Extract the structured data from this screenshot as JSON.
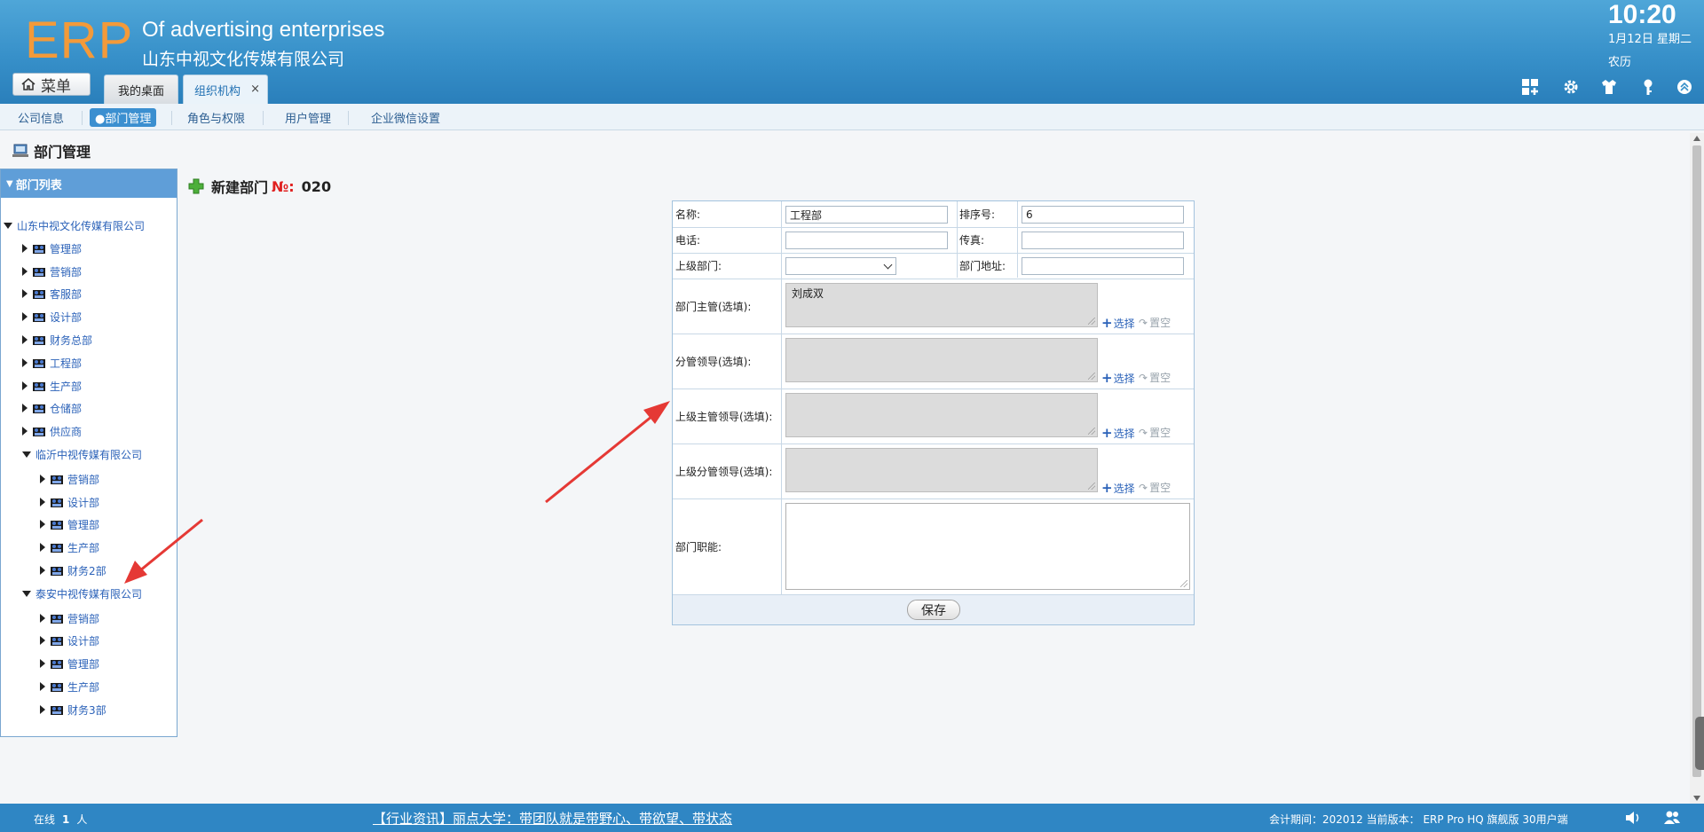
{
  "header": {
    "logo": "ERP",
    "company_en": "Of advertising enterprises",
    "company_cn": "山东中视文化传媒有限公司",
    "time": "10:20",
    "date": "1月12日 星期二",
    "lunar": "农历",
    "menu_label": "菜单",
    "tabs": [
      {
        "label": "我的桌面"
      },
      {
        "label": "组织机构",
        "close": "×"
      }
    ],
    "icons": [
      "layout-icon",
      "gear-icon",
      "shirt-icon",
      "key-icon",
      "collapse-up-icon"
    ]
  },
  "subnav": {
    "items": [
      {
        "label": "公司信息"
      },
      {
        "label": "●部门管理"
      },
      {
        "label": "角色与权限"
      },
      {
        "label": "用户管理"
      },
      {
        "label": "企业微信设置"
      }
    ]
  },
  "page_title": "部门管理",
  "tree": {
    "header": "部门列表",
    "root": "山东中视文化传媒有限公司",
    "root_children": [
      "管理部",
      "营销部",
      "客服部",
      "设计部",
      "财务总部",
      "工程部",
      "生产部",
      "仓储部",
      "供应商"
    ],
    "sub1": {
      "label": "临沂中视传媒有限公司",
      "children": [
        "营销部",
        "设计部",
        "管理部",
        "生产部",
        "财务2部"
      ]
    },
    "sub2": {
      "label": "泰安中视传媒有限公司",
      "children": [
        "营销部",
        "设计部",
        "管理部",
        "生产部",
        "财务3部"
      ]
    }
  },
  "form": {
    "heading": "新建部门",
    "no_label": "№:",
    "number": "020",
    "name_label": "名称:",
    "name_value": "工程部",
    "order_label": "排序号:",
    "order_value": "6",
    "phone_label": "电话:",
    "phone_value": "",
    "fax_label": "传真:",
    "fax_value": "",
    "parent_label": "上级部门:",
    "parent_value": "",
    "address_label": "部门地址:",
    "address_value": "",
    "manager_label": "部门主管(选填):",
    "manager_value": "刘成双",
    "leader_label": "分管领导(选填):",
    "leader_value": "",
    "upper_manager_label": "上级主管领导(选填):",
    "upper_manager_value": "",
    "upper_leader_label": "上级分管领导(选填):",
    "upper_leader_value": "",
    "duty_label": "部门职能:",
    "duty_value": "",
    "select_label": "选择",
    "clear_label": "置空",
    "save_label": "保存"
  },
  "footer": {
    "online_label": "在线",
    "online_count": "1",
    "online_unit": "人",
    "news": "【行业资讯】丽点大学：带团队就是带野心、带欲望、带状态",
    "version": "会计期间：202012  当前版本：  ERP Pro HQ 旗舰版 30用户端"
  },
  "colors": {
    "header_blue": "#3790c9",
    "logo_orange": "#f39a3a",
    "link_blue": "#2a61b8",
    "arrow_red": "#e53935",
    "no_red": "#e02020"
  }
}
